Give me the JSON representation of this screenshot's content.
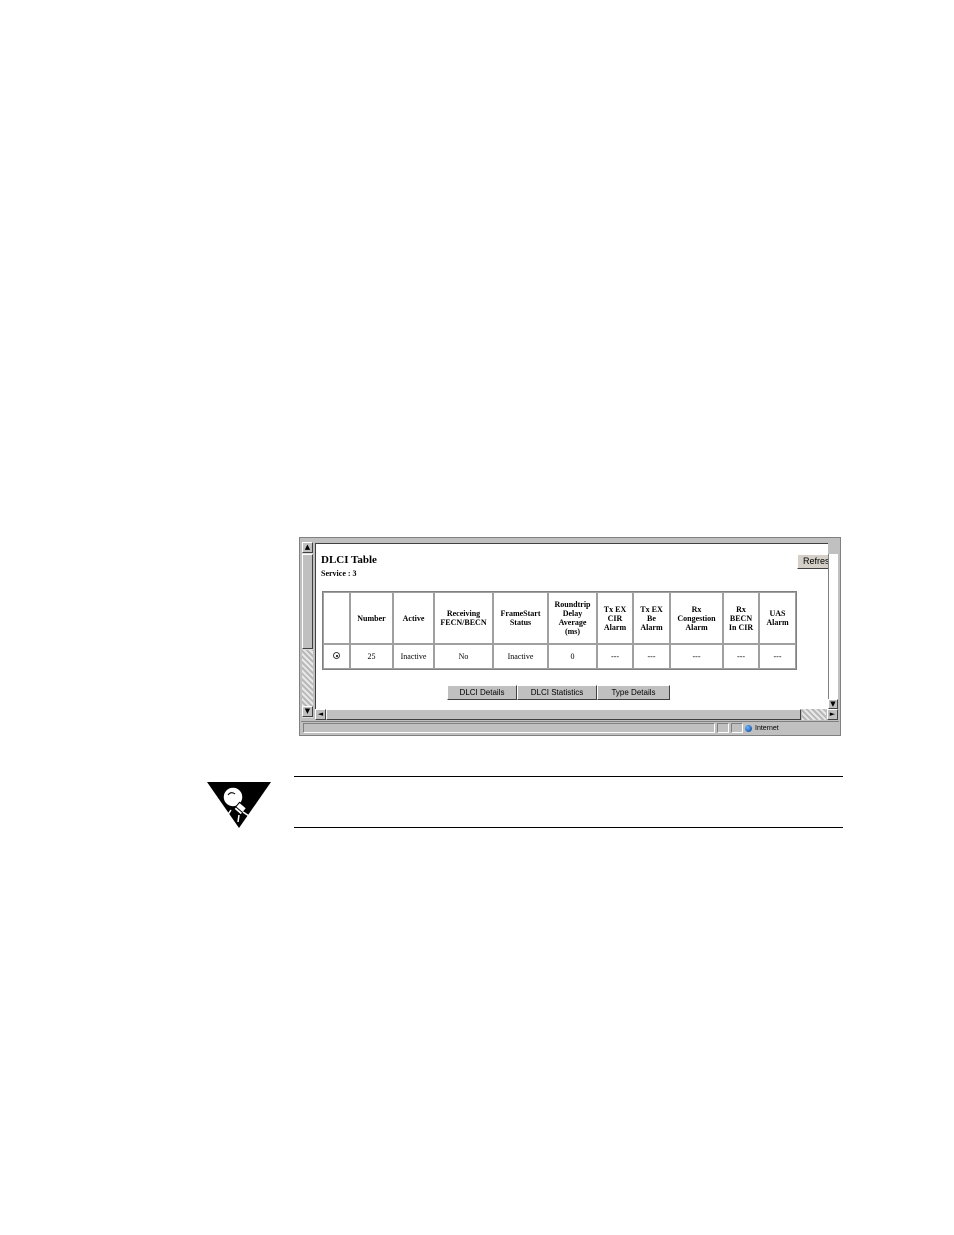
{
  "window": {
    "page_title": "DLCI Table",
    "service_label": "Service : 3",
    "refresh_label": "Refres"
  },
  "table": {
    "headers": [
      "",
      "Number",
      "Active",
      "Receiving FECN/BECN",
      "FrameStart Status",
      "Roundtrip Delay Average (ms)",
      "Tx EX CIR Alarm",
      "Tx EX Be Alarm",
      "Rx Congestion Alarm",
      "Rx BECN In CIR",
      "UAS Alarm"
    ],
    "rows": [
      {
        "selected": true,
        "cells": [
          "25",
          "Inactive",
          "No",
          "Inactive",
          "0",
          "---",
          "---",
          "---",
          "---",
          "---"
        ]
      }
    ]
  },
  "buttons": {
    "dlci_details": "DLCI Details",
    "dlci_statistics": "DLCI Statistics",
    "type_details": "Type Details"
  },
  "scrollbar": {
    "up_arrow": "▲",
    "down_arrow": "▼",
    "left_arrow": "◄",
    "right_arrow": "►"
  },
  "statusbar": {
    "zone_label": "Internet"
  },
  "icons": {
    "note_icon": "lightbulb-note-icon",
    "zone_icon": "globe-icon"
  },
  "colors": {
    "window_chrome": "#c0c0c0",
    "page_background": "#ffffff",
    "note_icon": "#000000"
  }
}
